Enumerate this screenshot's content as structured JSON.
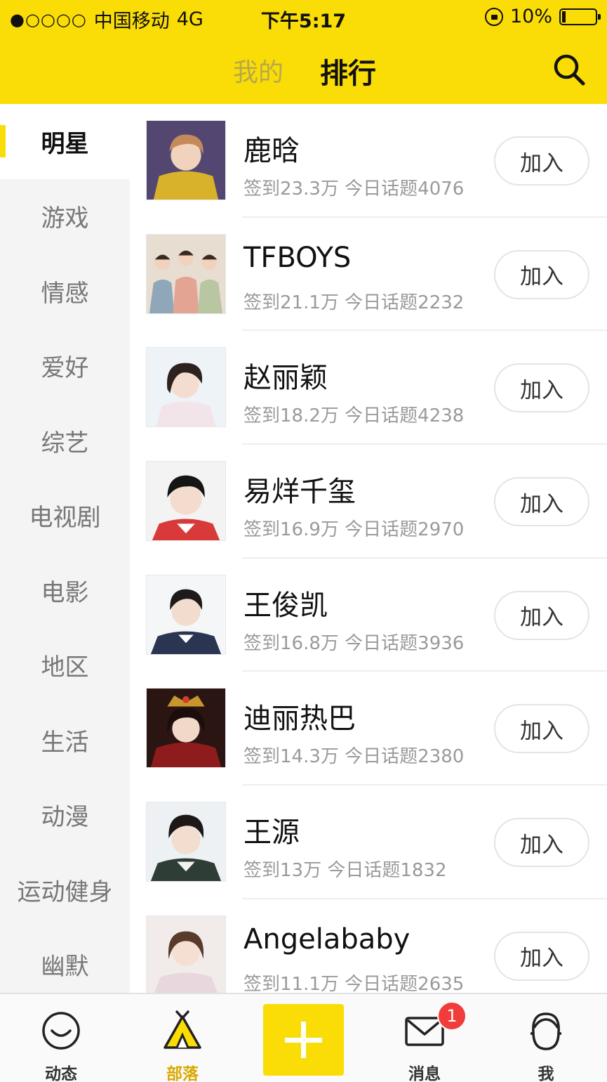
{
  "status_bar": {
    "signal": "●○○○○",
    "carrier": "中国移动",
    "network": "4G",
    "time": "下午5:17",
    "battery": "10%"
  },
  "header": {
    "tab_mine": "我的",
    "tab_rank": "排行",
    "search_icon": "search-icon",
    "accent_color": "#fadc07"
  },
  "sidebar": {
    "categories": [
      {
        "label": "明星",
        "active": true
      },
      {
        "label": "游戏"
      },
      {
        "label": "情感"
      },
      {
        "label": "爱好"
      },
      {
        "label": "综艺"
      },
      {
        "label": "电视剧"
      },
      {
        "label": "电影"
      },
      {
        "label": "地区"
      },
      {
        "label": "生活"
      },
      {
        "label": "动漫"
      },
      {
        "label": "运动健身"
      },
      {
        "label": "幽默"
      }
    ]
  },
  "ranking": {
    "join_label": "加入",
    "items": [
      {
        "name": "鹿晗",
        "stats": "签到23.3万 今日话题4076"
      },
      {
        "name": "TFBOYS",
        "stats": "签到21.1万 今日话题2232"
      },
      {
        "name": "赵丽颖",
        "stats": "签到18.2万 今日话题4238"
      },
      {
        "name": "易烊千玺",
        "stats": "签到16.9万 今日话题2970"
      },
      {
        "name": "王俊凯",
        "stats": "签到16.8万 今日话题3936"
      },
      {
        "name": "迪丽热巴",
        "stats": "签到14.3万 今日话题2380"
      },
      {
        "name": "王源",
        "stats": "签到13万 今日话题1832"
      },
      {
        "name": "Angelababy",
        "stats": "签到11.1万 今日话题2635"
      }
    ]
  },
  "tabbar": {
    "tabs": [
      {
        "label": "动态",
        "icon": "smile-face-icon"
      },
      {
        "label": "部落",
        "icon": "tent-icon",
        "active": true
      },
      {
        "label": "",
        "icon": "plus-icon"
      },
      {
        "label": "消息",
        "icon": "envelope-icon"
      },
      {
        "label": "我",
        "icon": "person-head-icon"
      }
    ],
    "message_badge": "1"
  }
}
